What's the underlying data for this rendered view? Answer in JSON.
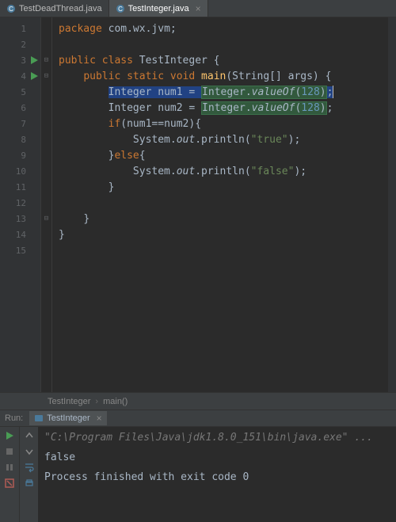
{
  "tabs": [
    {
      "label": "TestDeadThread.java",
      "active": false
    },
    {
      "label": "TestInteger.java",
      "active": true
    }
  ],
  "lines": [
    "1",
    "2",
    "3",
    "4",
    "5",
    "6",
    "7",
    "8",
    "9",
    "10",
    "11",
    "12",
    "13",
    "14",
    "15"
  ],
  "code": {
    "pkg_kw": "package ",
    "pkg_name": "com.wx.jvm",
    "semi": ";",
    "public": "public ",
    "class_kw": "class ",
    "class_name": "TestInteger",
    "lb": " {",
    "rb": "}",
    "static": "static ",
    "void": "void ",
    "main": "main",
    "main_args": "(String[] args)",
    "int_type": "Integer",
    "n1": " num1 ",
    "n2": " num2 ",
    "eq": "= ",
    "intprefix": "Integer.",
    "valueof": "valueOf",
    "paren_o": "(",
    "paren_c": ")",
    "val128": "128",
    "if_kw": "if",
    "cond": "(num1==num2){",
    "sysout_pre": "System.",
    "out": "out",
    "println": ".println(",
    "true_str": "\"true\"",
    "false_str": "\"false\"",
    "else_kw": "else",
    "else_o": "{",
    "indent1": "    ",
    "indent2": "        ",
    "indent3": "            ",
    "indent4": "                "
  },
  "breadcrumb": {
    "a": "TestInteger",
    "b": "main()"
  },
  "run": {
    "label": "Run:",
    "tab": "TestInteger",
    "cmd": "\"C:\\Program Files\\Java\\jdk1.8.0_151\\bin\\java.exe\" ...",
    "out1": "false",
    "out2": "Process finished with exit code 0"
  }
}
